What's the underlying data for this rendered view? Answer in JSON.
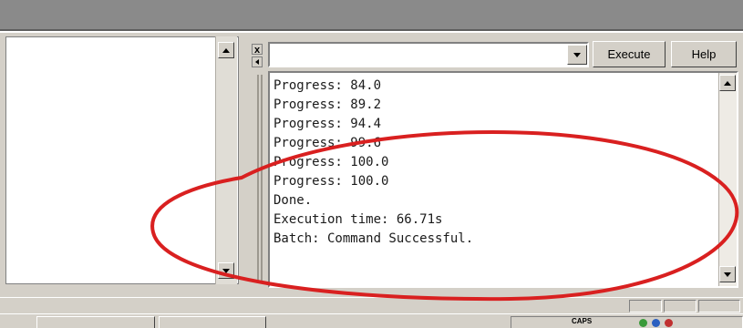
{
  "toolbar": {
    "close_glyph": "x",
    "execute_label": "Execute",
    "help_label": "Help",
    "command_value": ""
  },
  "output": {
    "lines": [
      "Progress: 84.0",
      "Progress: 89.2",
      "Progress: 94.4",
      "Progress: 99.6",
      "Progress: 100.0",
      "Progress: 100.0",
      "Done.",
      "Execution time: 66.71s",
      "Batch: Command Successful."
    ]
  },
  "taskbar": {
    "caps_label": "CAPS"
  },
  "colors": {
    "annotation": "#d92020",
    "panel": "#d4d0c8"
  }
}
